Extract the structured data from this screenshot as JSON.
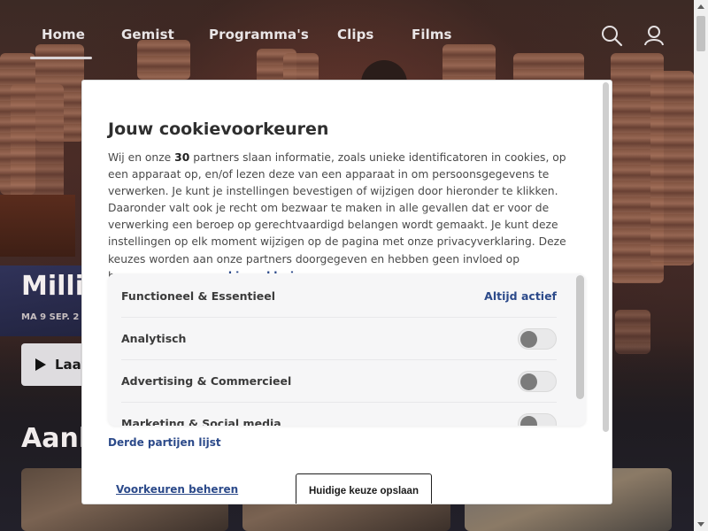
{
  "nav": {
    "items": [
      {
        "label": "Home"
      },
      {
        "label": "Gemist"
      },
      {
        "label": "Programma's"
      },
      {
        "label": "Clips"
      },
      {
        "label": "Films"
      }
    ],
    "icons": [
      "search-icon",
      "user-icon"
    ]
  },
  "hero": {
    "title": "Millic",
    "date": "MA 9 SEP. 2",
    "play_label": "Laat"
  },
  "section": {
    "title": "Aanb"
  },
  "modal": {
    "title": "Jouw cookievoorkeuren",
    "desc_part1": "Wij en onze ",
    "desc_bold": "30",
    "desc_part2": " partners slaan informatie, zoals unieke identificatoren in cookies, op een apparaat op, en/of lezen deze van een apparaat in om persoonsgegevens te verwerken. Je kunt je instellingen bevestigen of wijzigen door hieronder te klikken. Daaronder valt ook je recht om bezwaar te maken in alle gevallen dat er voor de verwerking een beroep op gerechtvaardigd belangen wordt gemaakt. Je kunt deze instellingen op elk moment wijzigen op de pagina met onze privacyverklaring. Deze keuzes worden aan onze partners doorgegeven en hebben geen invloed op browsegegevens. ",
    "desc_link": "cookieverklaring",
    "prefs": [
      {
        "label": "Functioneel & Essentieel",
        "status": "Altijd actief"
      },
      {
        "label": "Analytisch",
        "enabled": false
      },
      {
        "label": "Advertising & Commercieel",
        "enabled": false
      },
      {
        "label": "Marketing & Social media",
        "enabled": false
      }
    ],
    "third_party_label": "Derde partijen lijst",
    "manage_label": "Voorkeuren beheren",
    "save_label": "Huidige keuze opslaan"
  },
  "colors": {
    "link": "#2c4a8a",
    "toggle_off": "#7b7b7b"
  }
}
